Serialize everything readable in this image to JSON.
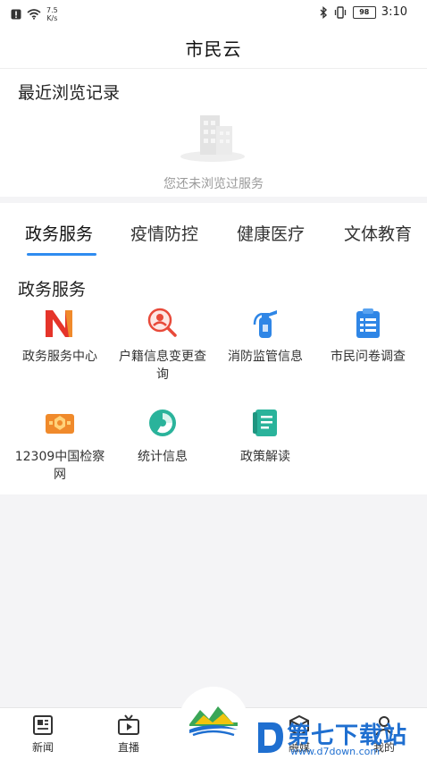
{
  "status": {
    "speed_value": "7.5",
    "speed_unit": "K/s",
    "battery": "98",
    "time": "3:10"
  },
  "app": {
    "title": "市民云"
  },
  "recent": {
    "heading": "最近浏览记录",
    "empty_text": "您还未浏览过服务"
  },
  "tabs": [
    {
      "label": "政务服务",
      "active": true
    },
    {
      "label": "疫情防控"
    },
    {
      "label": "健康医疗"
    },
    {
      "label": "文体教育"
    }
  ],
  "section": {
    "title": "政务服务"
  },
  "services": [
    {
      "label": "政务服务中心",
      "icon": "n-logo-icon",
      "color": "#e5342a"
    },
    {
      "label": "户籍信息变更查询",
      "icon": "person-search-icon",
      "color": "#e84a3a"
    },
    {
      "label": "消防监管信息",
      "icon": "fire-extinguisher-icon",
      "color": "#2f86e6"
    },
    {
      "label": "市民问卷调查",
      "icon": "clipboard-icon",
      "color": "#2f86e6"
    },
    {
      "label": "12309中国检察网",
      "icon": "procuratorate-badge-icon",
      "color": "#f08a2b"
    },
    {
      "label": "统计信息",
      "icon": "pie-chart-icon",
      "color": "#2ab39b"
    },
    {
      "label": "政策解读",
      "icon": "book-icon",
      "color": "#2ab39b"
    }
  ],
  "nav": [
    {
      "label": "新闻",
      "icon": "news-icon"
    },
    {
      "label": "直播",
      "icon": "tv-icon"
    },
    {
      "label": "融媒",
      "icon": "cube-icon"
    },
    {
      "label": "我的",
      "icon": "person-icon"
    }
  ],
  "watermark": {
    "text": "第七下载站",
    "url": "www.d7down.com"
  }
}
